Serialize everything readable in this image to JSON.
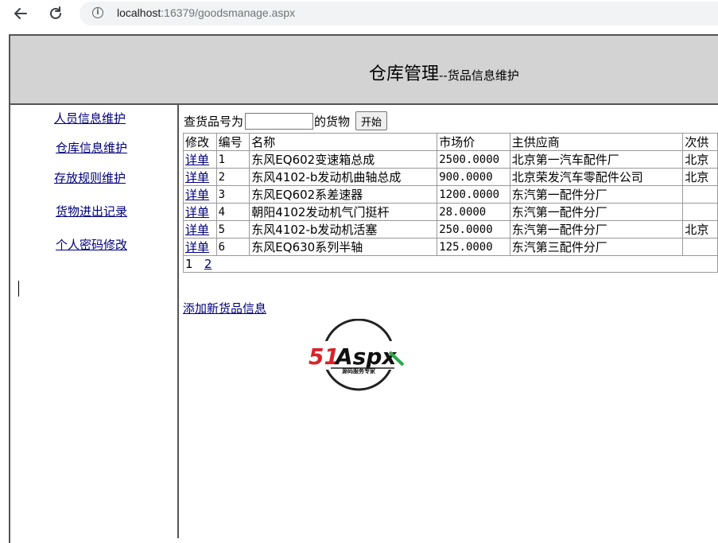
{
  "browser": {
    "url_host": "localhost",
    "url_rest": ":16379/goodsmanage.aspx"
  },
  "header": {
    "title": "仓库管理",
    "subtitle": "--货品信息维护"
  },
  "sidebar": {
    "items": [
      {
        "label": "人员信息维护"
      },
      {
        "label": "仓库信息维护"
      },
      {
        "label": "存放规则维护"
      },
      {
        "label": "货物进出记录"
      },
      {
        "label": "个人密码修改"
      }
    ]
  },
  "search": {
    "prefix": "查货品号为",
    "value": "",
    "suffix": "的货物",
    "button": "开始"
  },
  "table": {
    "headers": [
      "修改",
      "编号",
      "名称",
      "市场价",
      "主供应商",
      "次供"
    ],
    "rows": [
      {
        "edit": "详单",
        "id": "1",
        "name": "东风EQ602变速箱总成",
        "price": "2500.0000",
        "supplier": "北京第一汽车配件厂",
        "supplier2": "北京"
      },
      {
        "edit": "详单",
        "id": "2",
        "name": "东风4102-b发动机曲轴总成",
        "price": "900.0000",
        "supplier": "北京荣发汽车零配件公司",
        "supplier2": "北京"
      },
      {
        "edit": "详单",
        "id": "3",
        "name": "东风EQ602系差速器",
        "price": "1200.0000",
        "supplier": "东汽第一配件分厂",
        "supplier2": ""
      },
      {
        "edit": "详单",
        "id": "4",
        "name": "朝阳4102发动机气门挺杆",
        "price": "28.0000",
        "supplier": "东汽第一配件分厂",
        "supplier2": ""
      },
      {
        "edit": "详单",
        "id": "5",
        "name": "东风4102-b发动机活塞",
        "price": "250.0000",
        "supplier": "东汽第一配件分厂",
        "supplier2": "北京"
      },
      {
        "edit": "详单",
        "id": "6",
        "name": "东风EQ630系列半轴",
        "price": "125.0000",
        "supplier": "东汽第三配件分厂",
        "supplier2": ""
      }
    ],
    "pager": {
      "current": "1",
      "next": "2"
    }
  },
  "add_link": "添加新货品信息",
  "logo": {
    "text": "51Aspx",
    "tagline": "源码服务专家"
  },
  "colors": {
    "header_bg": "#d3d3d3",
    "link": "#000080",
    "logo_red": "#d8232a",
    "logo_green": "#2aa84a"
  },
  "icons": [
    "back-arrow-icon",
    "reload-icon",
    "info-icon"
  ]
}
